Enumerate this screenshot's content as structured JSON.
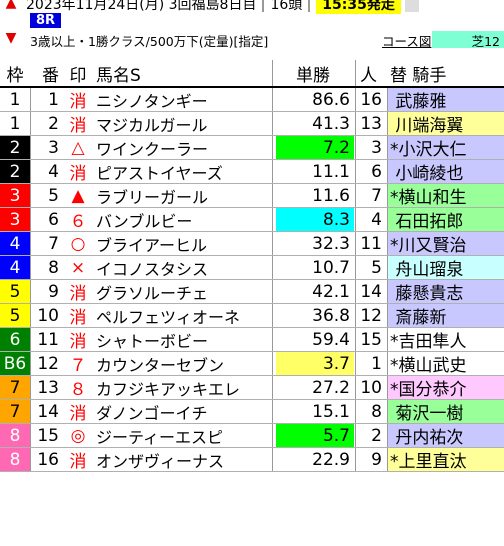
{
  "header": {
    "date_line": "2023年11月24日(月) 3回福島8日目",
    "heads": "16頭",
    "status": "15:35発走",
    "race_no": "8R",
    "conditions": "3歳以上・1勝クラス/500万下(定量)[指定]",
    "course_link": "コース図",
    "distance": "芝12",
    "arrow_up": "▲",
    "arrow_down": "▼"
  },
  "columns": {
    "waku": "枠",
    "uma": "番",
    "mark": "印",
    "name": "馬名S",
    "odds": "単勝",
    "ninki": "人",
    "jockey": "替 騎手"
  },
  "colors": {
    "odds_min": "#00ff00",
    "odds_second": "#ffff66",
    "odds_third": "#00ffff"
  },
  "rows": [
    {
      "waku": "1",
      "waku_bg": "#ffffff",
      "waku_fg": "#000000",
      "uma": "1",
      "mark": "消",
      "name": "ニシノタンギー",
      "odds": "86.6",
      "ninki": "16",
      "jockey": " 武藤雅",
      "jockey_bg": "#c8c8ff",
      "odds_bg": "#ffffff"
    },
    {
      "waku": "1",
      "waku_bg": "#ffffff",
      "waku_fg": "#000000",
      "uma": "2",
      "mark": "消",
      "name": "マジカルガール",
      "odds": "41.3",
      "ninki": "13",
      "jockey": " 川端海翼",
      "jockey_bg": "#ffff99",
      "odds_bg": "#ffffff"
    },
    {
      "waku": "2",
      "waku_bg": "#000000",
      "waku_fg": "#ffffff",
      "uma": "3",
      "mark": "△",
      "name": "ワインクーラー",
      "odds": "7.2",
      "ninki": "3",
      "jockey": "*小沢大仁",
      "jockey_bg": "#c8c8ff",
      "odds_bg": "#00ff00"
    },
    {
      "waku": "2",
      "waku_bg": "#000000",
      "waku_fg": "#ffffff",
      "uma": "4",
      "mark": "消",
      "name": "ピアストイヤーズ",
      "odds": "11.1",
      "ninki": "6",
      "jockey": " 小崎綾也",
      "jockey_bg": "#c8c8ff",
      "odds_bg": "#ffffff"
    },
    {
      "waku": "3",
      "waku_bg": "#ff0000",
      "waku_fg": "#ffffff",
      "uma": "5",
      "mark": "▲",
      "name": "ラブリーガール",
      "odds": "11.6",
      "ninki": "7",
      "jockey": "*横山和生",
      "jockey_bg": "#99ff99",
      "odds_bg": "#ffffff"
    },
    {
      "waku": "3",
      "waku_bg": "#ff0000",
      "waku_fg": "#ffffff",
      "uma": "6",
      "mark": "６",
      "name": "バンブルビー",
      "odds": "8.3",
      "ninki": "4",
      "jockey": " 石田拓郎",
      "jockey_bg": "#99ff99",
      "odds_bg": "#00ffff"
    },
    {
      "waku": "4",
      "waku_bg": "#0000ff",
      "waku_fg": "#ffffff",
      "uma": "7",
      "mark": "○",
      "name": "ブライアーヒル",
      "odds": "32.3",
      "ninki": "11",
      "jockey": "*川又賢治",
      "jockey_bg": "#c8c8ff",
      "odds_bg": "#ffffff"
    },
    {
      "waku": "4",
      "waku_bg": "#0000ff",
      "waku_fg": "#ffffff",
      "uma": "8",
      "mark": "×",
      "name": "イコノスタシス",
      "odds": "10.7",
      "ninki": "5",
      "jockey": " 舟山瑠泉",
      "jockey_bg": "#c8ffff",
      "odds_bg": "#ffffff"
    },
    {
      "waku": "5",
      "waku_bg": "#ffff00",
      "waku_fg": "#000000",
      "uma": "9",
      "mark": "消",
      "name": "グラソルーチェ",
      "odds": "42.1",
      "ninki": "14",
      "jockey": " 藤懸貴志",
      "jockey_bg": "#c8c8ff",
      "odds_bg": "#ffffff"
    },
    {
      "waku": "5",
      "waku_bg": "#ffff00",
      "waku_fg": "#000000",
      "uma": "10",
      "mark": "消",
      "name": "ペルフェツィオーネ",
      "odds": "36.8",
      "ninki": "12",
      "jockey": " 斎藤新",
      "jockey_bg": "#c8c8ff",
      "odds_bg": "#ffffff"
    },
    {
      "waku": "6",
      "waku_bg": "#008000",
      "waku_fg": "#ffffff",
      "uma": "11",
      "mark": "消",
      "name": "シャトーボビー",
      "odds": "59.4",
      "ninki": "15",
      "jockey": "*吉田隼人",
      "jockey_bg": "#ffffff",
      "odds_bg": "#ffffff"
    },
    {
      "waku": "B6",
      "waku_bg": "#008000",
      "waku_fg": "#ffffff",
      "uma": "12",
      "mark": "７",
      "name": "カウンターセブン",
      "odds": "3.7",
      "ninki": "1",
      "jockey": "*横山武史",
      "jockey_bg": "#ffffff",
      "odds_bg": "#ffff66"
    },
    {
      "waku": "7",
      "waku_bg": "#ffa500",
      "waku_fg": "#000000",
      "uma": "13",
      "mark": "８",
      "name": "カフジキアッキエレ",
      "odds": "27.2",
      "ninki": "10",
      "jockey": "*国分恭介",
      "jockey_bg": "#ffc8ff",
      "odds_bg": "#ffffff"
    },
    {
      "waku": "7",
      "waku_bg": "#ffa500",
      "waku_fg": "#000000",
      "uma": "14",
      "mark": "消",
      "name": "ダノンゴーイチ",
      "odds": "15.1",
      "ninki": "8",
      "jockey": " 菊沢一樹",
      "jockey_bg": "#99ff99",
      "odds_bg": "#ffffff"
    },
    {
      "waku": "8",
      "waku_bg": "#ff69b4",
      "waku_fg": "#ffffff",
      "uma": "15",
      "mark": "◎",
      "name": "ジーティーエスピ",
      "odds": "5.7",
      "ninki": "2",
      "jockey": " 丹内祐次",
      "jockey_bg": "#c8c8ff",
      "odds_bg": "#00ff00"
    },
    {
      "waku": "8",
      "waku_bg": "#ff69b4",
      "waku_fg": "#ffffff",
      "uma": "16",
      "mark": "消",
      "name": "オンザヴィーナス",
      "odds": "22.9",
      "ninki": "9",
      "jockey": "*上里直汰",
      "jockey_bg": "#ffff99",
      "odds_bg": "#ffffff"
    }
  ]
}
